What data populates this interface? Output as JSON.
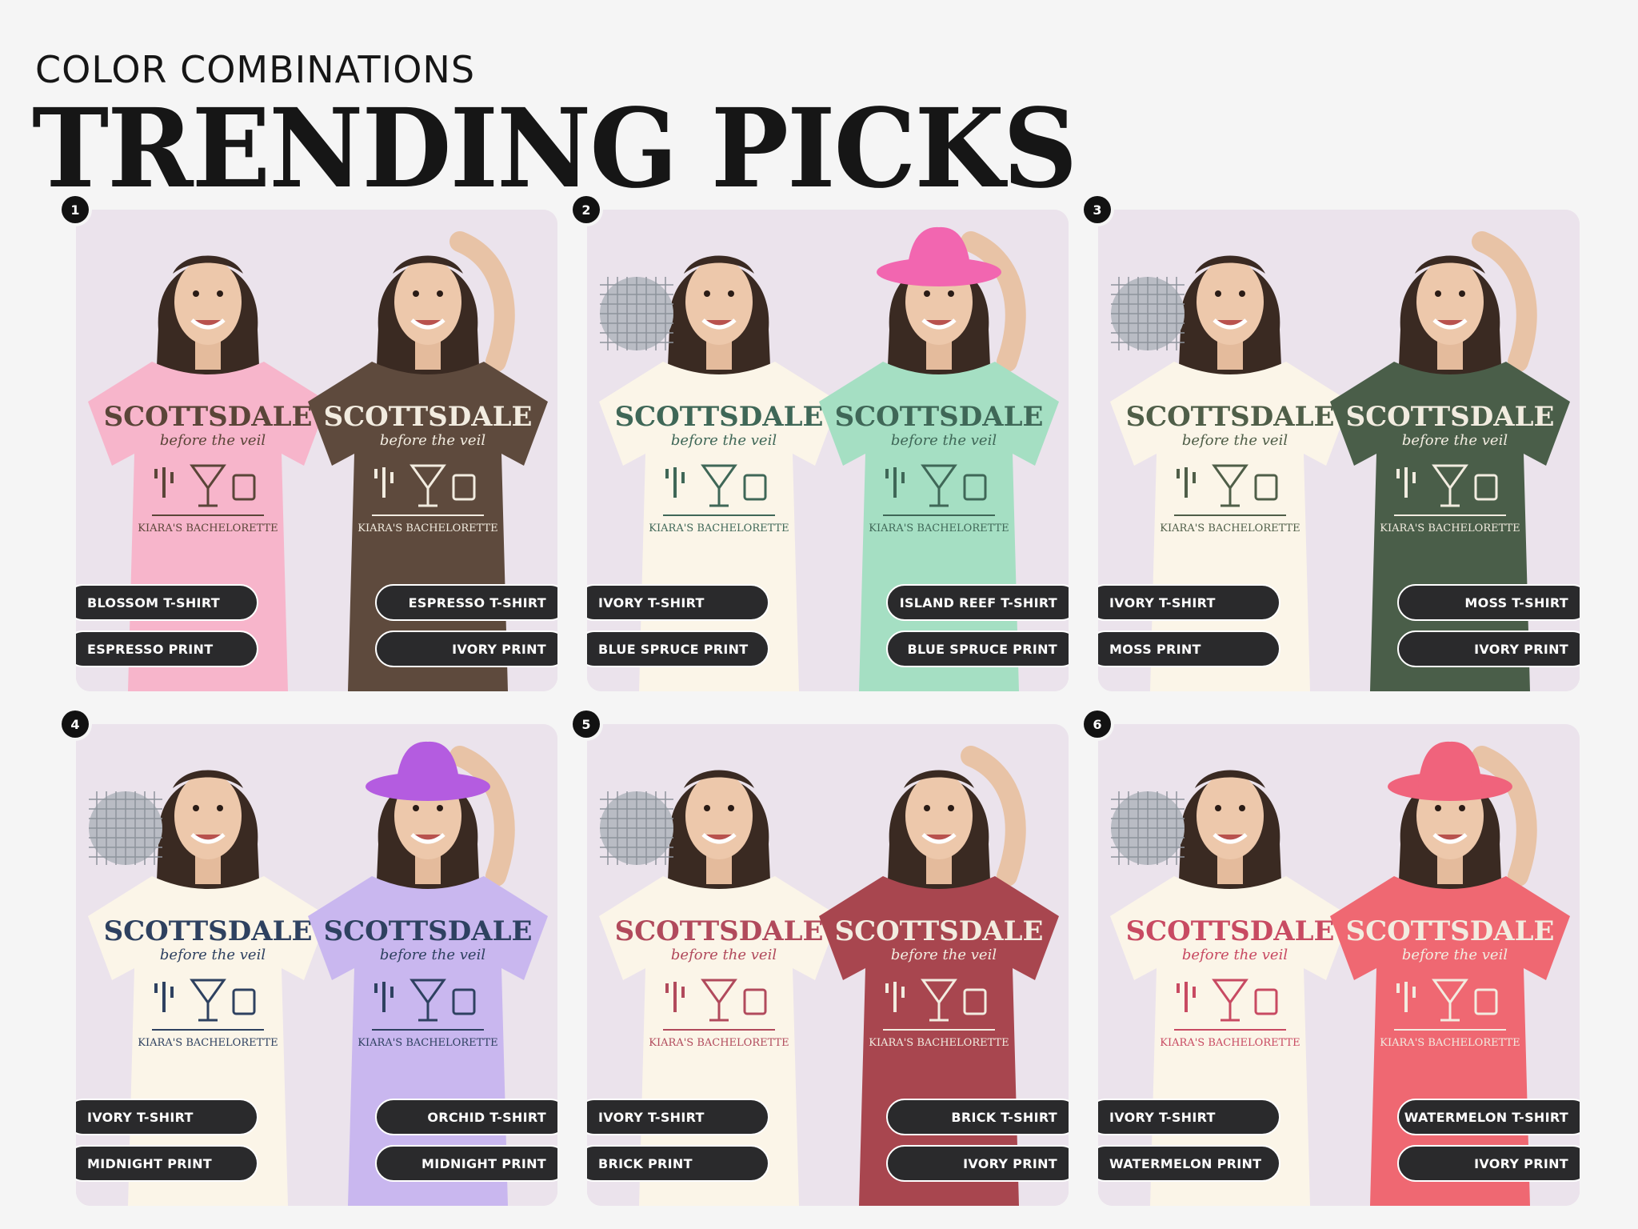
{
  "header": {
    "eyebrow": "COLOR COMBINATIONS",
    "title": "TRENDING PICKS"
  },
  "shirt_print_text": {
    "line1": "SCOTTSDALE",
    "line2": "before the veil",
    "line3": "KIARA'S BACHELORETTE"
  },
  "cards": [
    {
      "number": "1",
      "left_shirt": {
        "label": "BLOSSOM T-SHIRT",
        "print_label": "ESPRESSO PRINT",
        "shirt_color": "#f7b5cb",
        "print_color": "#5a4538"
      },
      "right_shirt": {
        "label": "ESPRESSO T-SHIRT",
        "print_label": "IVORY PRINT",
        "shirt_color": "#5e4a3d",
        "print_color": "#f2ece0"
      },
      "accessories": {
        "disco_ball": false,
        "hat_color": ""
      }
    },
    {
      "number": "2",
      "left_shirt": {
        "label": "IVORY T-SHIRT",
        "print_label": "BLUE SPRUCE PRINT",
        "shirt_color": "#fbf5e8",
        "print_color": "#3f6757"
      },
      "right_shirt": {
        "label": "ISLAND REEF T-SHIRT",
        "print_label": "BLUE SPRUCE PRINT",
        "shirt_color": "#a5dfc3",
        "print_color": "#3f6757"
      },
      "accessories": {
        "disco_ball": true,
        "hat_color": "#f266b0"
      }
    },
    {
      "number": "3",
      "left_shirt": {
        "label": "IVORY T-SHIRT",
        "print_label": "MOSS PRINT",
        "shirt_color": "#fbf5e8",
        "print_color": "#4f5e48"
      },
      "right_shirt": {
        "label": "MOSS T-SHIRT",
        "print_label": "IVORY PRINT",
        "shirt_color": "#4a5e49",
        "print_color": "#f2ece0"
      },
      "accessories": {
        "disco_ball": true,
        "hat_color": ""
      }
    },
    {
      "number": "4",
      "left_shirt": {
        "label": "IVORY T-SHIRT",
        "print_label": "MIDNIGHT PRINT",
        "shirt_color": "#fbf5e8",
        "print_color": "#2e4160"
      },
      "right_shirt": {
        "label": "ORCHID T-SHIRT",
        "print_label": "MIDNIGHT PRINT",
        "shirt_color": "#c9b7ef",
        "print_color": "#2e4160"
      },
      "accessories": {
        "disco_ball": true,
        "hat_color": "#b45ce0"
      }
    },
    {
      "number": "5",
      "left_shirt": {
        "label": "IVORY T-SHIRT",
        "print_label": "BRICK PRINT",
        "shirt_color": "#fbf5e8",
        "print_color": "#b14a5c"
      },
      "right_shirt": {
        "label": "BRICK T-SHIRT",
        "print_label": "IVORY PRINT",
        "shirt_color": "#a8464f",
        "print_color": "#f2ece0"
      },
      "accessories": {
        "disco_ball": true,
        "hat_color": ""
      }
    },
    {
      "number": "6",
      "left_shirt": {
        "label": "IVORY T-SHIRT",
        "print_label": "WATERMELON PRINT",
        "shirt_color": "#fbf5e8",
        "print_color": "#c84a62"
      },
      "right_shirt": {
        "label": "WATERMELON T-SHIRT",
        "print_label": "IVORY PRINT",
        "shirt_color": "#ef6872",
        "print_color": "#f2ece0"
      },
      "accessories": {
        "disco_ball": true,
        "hat_color": "#f0637c"
      }
    }
  ]
}
